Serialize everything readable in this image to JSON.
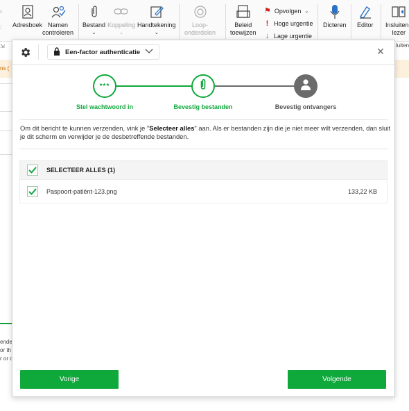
{
  "ribbon": {
    "adresboek": "Adresboek",
    "namen_1": "Namen",
    "namen_2": "controleren",
    "bestand": "Bestand",
    "koppeling": "Koppeling",
    "handtekening": "Handtekening",
    "loop_1": "Loop-",
    "loop_2": "onderdelen",
    "beleid_1": "Beleid",
    "beleid_2": "toewijzen",
    "opvolgen": "Opvolgen",
    "hoge_urgentie": "Hoge urgentie",
    "lage_urgentie": "Lage urgentie",
    "dicteren": "Dicteren",
    "editor": "Editor",
    "insluitend_1": "Insluitend",
    "insluitend_2": "lezer",
    "insluitend_3": "luiten"
  },
  "background": {
    "orange_fragment": "ns (",
    "text_fragment_1": "ende",
    "text_fragment_2": "or th",
    "text_fragment_3": "r or c"
  },
  "colors": {
    "accent_green": "#0fa83b",
    "step_inactive": "#6b6b6b",
    "warning_strip": "#fdf0dc"
  },
  "modal": {
    "auth_mode": "Een-factor authenticatie",
    "close_icon": "×",
    "steps": [
      {
        "label": "Stel wachtwoord in",
        "state": "done",
        "icon": "password-dots-icon"
      },
      {
        "label": "Bevestig bestanden",
        "state": "active",
        "icon": "paperclip-icon"
      },
      {
        "label": "Bevestig ontvangers",
        "state": "pending",
        "icon": "person-icon"
      }
    ],
    "description_part1": "Om dit bericht te kunnen verzenden, vink je \"",
    "description_bold": "Selecteer alles",
    "description_part2": "\" aan. Als er bestanden zijn die je niet meer wilt verzenden, dan sluit je dit scherm en verwijder je de desbetreffende bestanden.",
    "select_all_label": "SELECTEER ALLES (1)",
    "files": [
      {
        "name": "Paspoort-patiënt-123.png",
        "size": "133,22 KB",
        "checked": true
      }
    ],
    "back_button": "Vorige",
    "next_button": "Volgende"
  }
}
